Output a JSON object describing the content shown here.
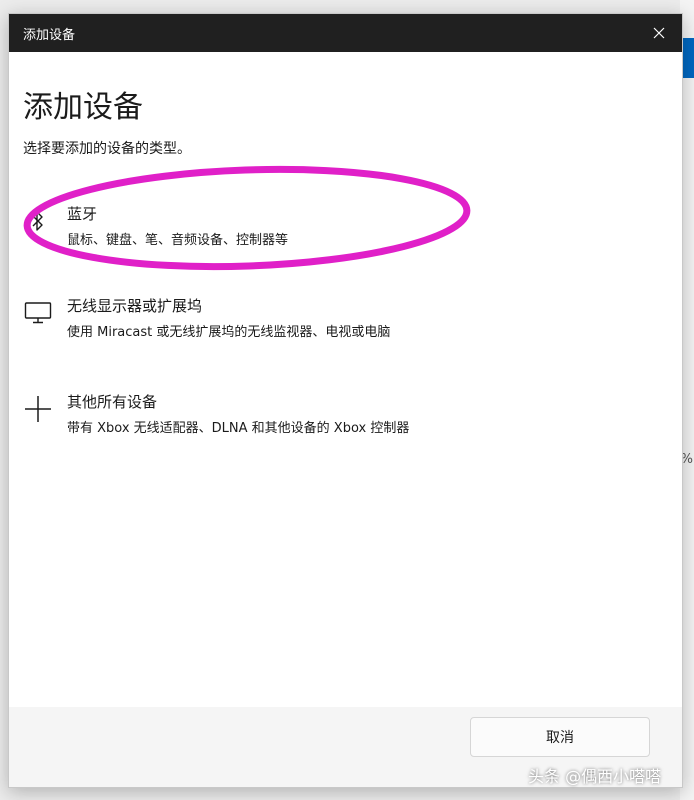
{
  "window": {
    "title": "添加设备",
    "close_icon": "close-icon"
  },
  "main": {
    "heading": "添加设备",
    "subtitle": "选择要添加的设备的类型。",
    "options": [
      {
        "icon": "bluetooth-icon",
        "title": "蓝牙",
        "description": "鼠标、键盘、笔、音频设备、控制器等"
      },
      {
        "icon": "monitor-icon",
        "title": "无线显示器或扩展坞",
        "description": "使用 Miracast 或无线扩展坞的无线监视器、电视或电脑"
      },
      {
        "icon": "plus-icon",
        "title": "其他所有设备",
        "description": "带有 Xbox 无线适配器、DLNA 和其他设备的 Xbox 控制器"
      }
    ]
  },
  "footer": {
    "cancel_label": "取消"
  },
  "background": {
    "percent_fragment": "%"
  },
  "watermark": {
    "text": "头条 @偶西小嗒嗒"
  },
  "colors": {
    "titlebar": "#202020",
    "highlight": "#e020c8",
    "accent": "#0067c0"
  }
}
